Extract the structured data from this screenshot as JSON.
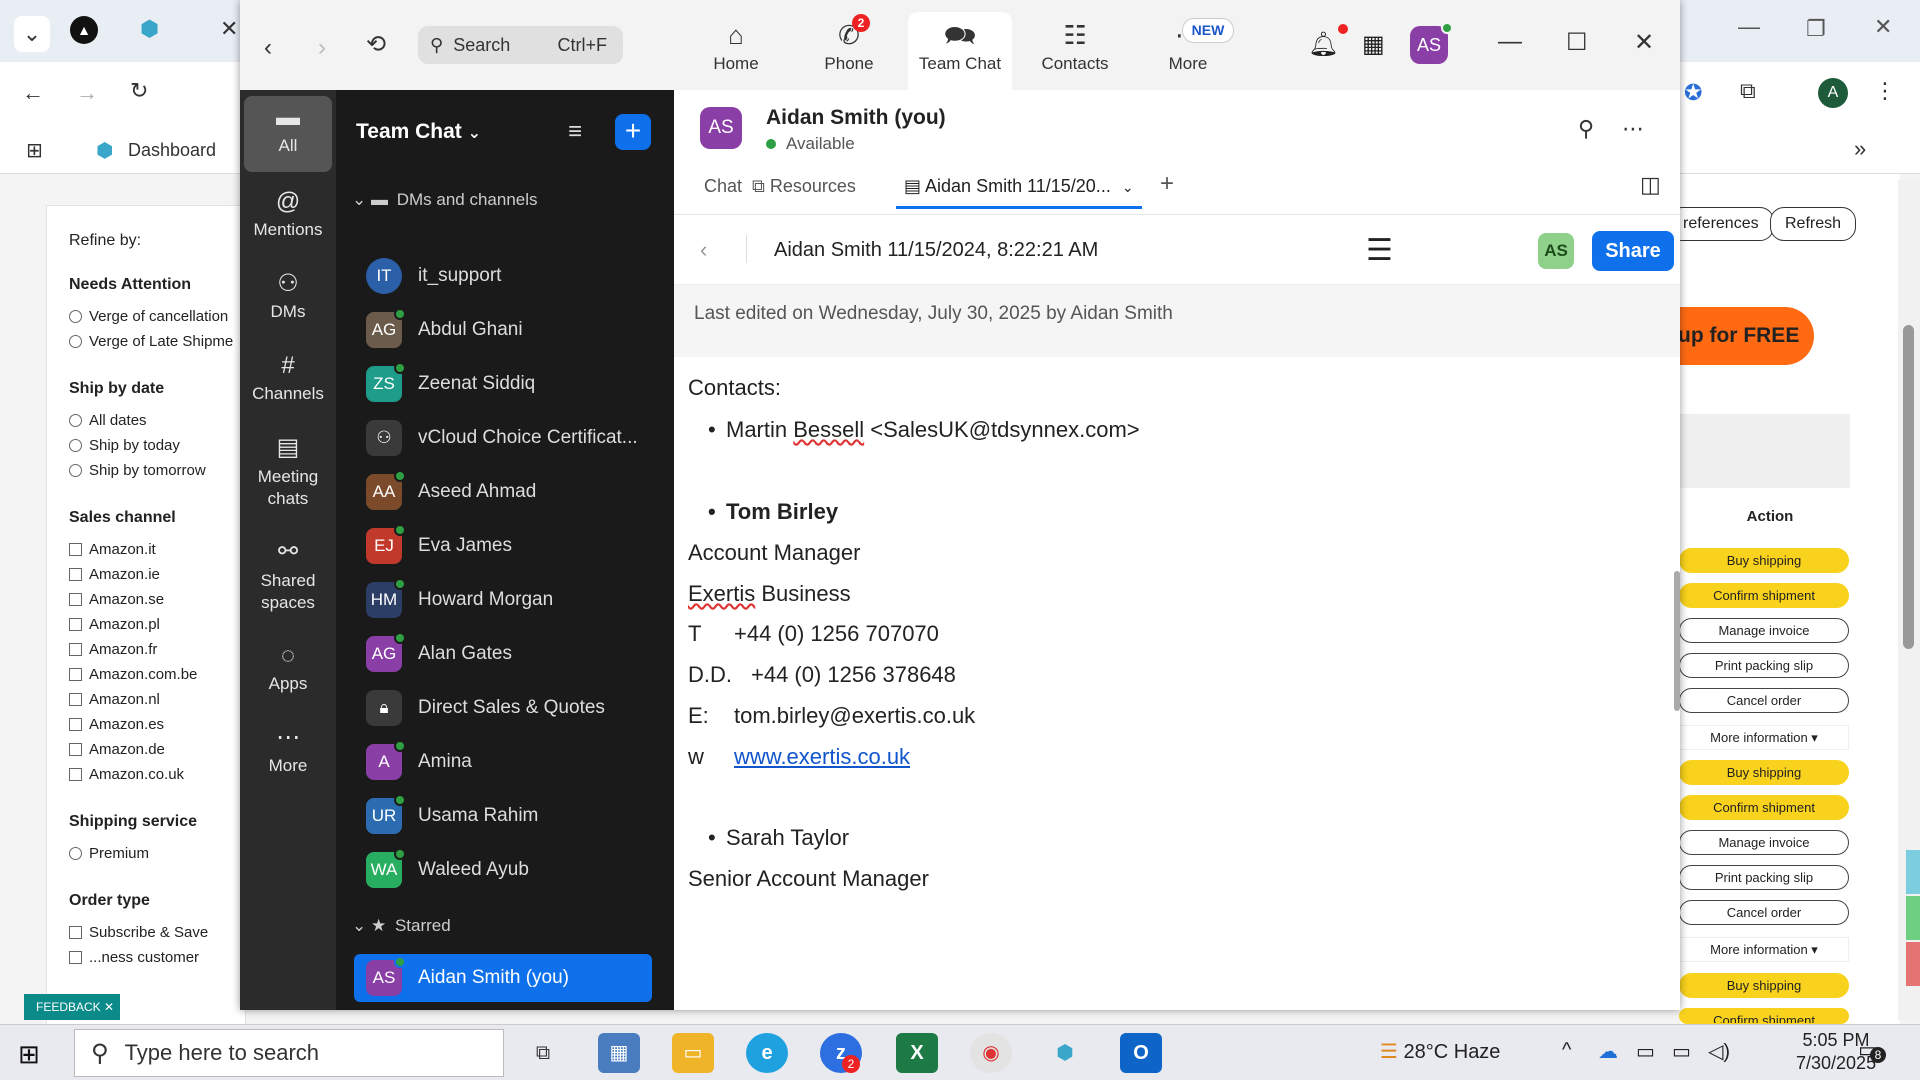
{
  "browser": {
    "dashboard_label": "Dashboard",
    "profile_initial": "A"
  },
  "refine": {
    "title": "Refine by:",
    "needs_attention": {
      "heading": "Needs Attention",
      "options": [
        "Verge of cancellation",
        "Verge of Late Shipme"
      ]
    },
    "ship_by_date": {
      "heading": "Ship by date",
      "options": [
        "All dates",
        "Ship by today",
        "Ship by tomorrow"
      ]
    },
    "sales_channel": {
      "heading": "Sales channel",
      "options": [
        "Amazon.it",
        "Amazon.ie",
        "Amazon.se",
        "Amazon.pl",
        "Amazon.fr",
        "Amazon.com.be",
        "Amazon.nl",
        "Amazon.es",
        "Amazon.de",
        "Amazon.co.uk"
      ]
    },
    "shipping_service": {
      "heading": "Shipping service",
      "options": [
        "Premium"
      ]
    },
    "order_type": {
      "heading": "Order type",
      "options": [
        "Subscribe & Save",
        "...ness customer"
      ]
    }
  },
  "feedback_label": "FEEDBACK",
  "right_pane": {
    "preferences_label": "references",
    "refresh_label": "Refresh",
    "signup_label": "up for FREE",
    "action_header": "Action",
    "actions": [
      "Buy shipping",
      "Confirm shipment",
      "Manage invoice",
      "Print packing slip",
      "Cancel order",
      "More information ▾",
      "Buy shipping",
      "Confirm shipment",
      "Manage invoice",
      "Print packing slip",
      "Cancel order",
      "More information ▾",
      "Buy shipping",
      "Confirm shipment"
    ]
  },
  "zoom": {
    "search_placeholder": "Search",
    "search_shortcut": "Ctrl+F",
    "tabs": [
      {
        "label": "Home",
        "icon": "home-icon"
      },
      {
        "label": "Phone",
        "icon": "phone-icon"
      },
      {
        "label": "Team Chat",
        "icon": "chat-icon"
      },
      {
        "label": "Contacts",
        "icon": "contacts-icon"
      },
      {
        "label": "More",
        "icon": "more-icon"
      }
    ],
    "phone_badge": "2",
    "new_badge": "NEW",
    "user_initials": "AS",
    "rail": [
      "All",
      "Mentions",
      "DMs",
      "Channels",
      "Meeting chats",
      "Shared spaces",
      "Apps",
      "More"
    ],
    "panel_title": "Team Chat",
    "section_dms": "DMs and channels",
    "section_starred": "Starred",
    "channels": [
      {
        "name": "it_support",
        "initials": "IT",
        "color": "#2b5fa8"
      },
      {
        "name": "Abdul Ghani",
        "initials": "AG",
        "color": "#6b5b4b"
      },
      {
        "name": "Zeenat Siddiq",
        "initials": "ZS",
        "color": "#1f9d8b"
      },
      {
        "name": "vCloud Choice Certificat...",
        "initials": "",
        "color": "#3a3a3a"
      },
      {
        "name": "Aseed Ahmad",
        "initials": "AA",
        "color": "#7a4a2a"
      },
      {
        "name": "Eva James",
        "initials": "EJ",
        "color": "#c0392b"
      },
      {
        "name": "Howard Morgan",
        "initials": "HM",
        "color": "#2c3e66"
      },
      {
        "name": "Alan Gates",
        "initials": "AG",
        "color": "#8a3fa7"
      },
      {
        "name": "Direct Sales & Quotes",
        "initials": "",
        "color": "#3a3a3a"
      },
      {
        "name": "Amina",
        "initials": "A",
        "color": "#8a3fa7"
      },
      {
        "name": "Usama Rahim",
        "initials": "UR",
        "color": "#2b6cb0"
      },
      {
        "name": "Waleed Ayub",
        "initials": "WA",
        "color": "#27ae60"
      }
    ],
    "starred": {
      "name": "Aidan Smith (you)",
      "initials": "AS"
    },
    "header": {
      "name": "Aidan Smith (you)",
      "status": "Available",
      "initials": "AS"
    },
    "content_tabs": [
      "Chat",
      "Resources",
      "Aidan Smith 11/15/20..."
    ],
    "doc": {
      "title": "Aidan Smith 11/15/2024, 8:22:21 AM",
      "share_label": "Share",
      "avatar_initials": "AS",
      "edited": "Last edited on Wednesday, July 30, 2025 by Aidan Smith",
      "contacts_label": "Contacts:",
      "martin_first": "Martin ",
      "martin_last": "Bessell",
      "martin_email": " <SalesUK@tdsynnex.com>",
      "tom_name": "Tom Birley",
      "tom_title": "Account Manager",
      "tom_company_first": "Exertis",
      "tom_company_rest": " Business",
      "t_label": "T",
      "t_value": "+44 (0) 1256 707070",
      "dd_label": "D.D.",
      "dd_value": "+44 (0) 1256 378648",
      "e_label": "E:",
      "e_value": "tom.birley@exertis.co.uk",
      "w_label": "w",
      "w_value": "www.exertis.co.uk",
      "sarah_name": "Sarah Taylor",
      "sarah_title": "Senior Account Manager"
    }
  },
  "taskbar": {
    "search_placeholder": "Type here to search",
    "zoom_badge": "2",
    "weather": "28°C  Haze",
    "time": "5:05 PM",
    "date": "7/30/2025",
    "notif_count": "8"
  }
}
